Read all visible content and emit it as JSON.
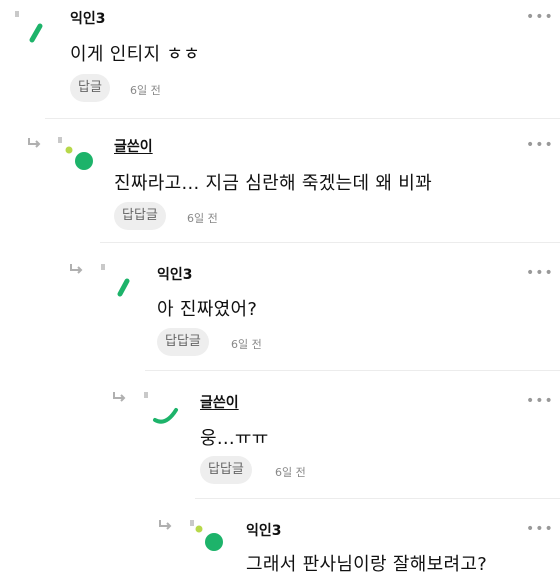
{
  "comments": [
    {
      "author": "익인3",
      "text": "이게 인티지 ㅎㅎ",
      "reply_label": "답글",
      "time": "6일 전",
      "more": "•••"
    },
    {
      "author": "글쓴이",
      "text": "진짜라고... 지금 심란해 죽겠는데 왜 비꽈",
      "reply_label": "답답글",
      "time": "6일 전",
      "more": "•••"
    },
    {
      "author": "익인3",
      "text": "아 진짜였어?",
      "reply_label": "답답글",
      "time": "6일 전",
      "more": "•••"
    },
    {
      "author": "글쓴이",
      "text": "웅...ㅠㅠ",
      "reply_label": "답답글",
      "time": "6일 전",
      "more": "•••"
    },
    {
      "author": "익인3",
      "text": "그래서 판사님이랑 잘해보려고?",
      "more": "•••"
    }
  ],
  "colors": {
    "accent_green": "#1db36a",
    "yellow_green": "#b7d84a",
    "divider": "#ececec"
  }
}
